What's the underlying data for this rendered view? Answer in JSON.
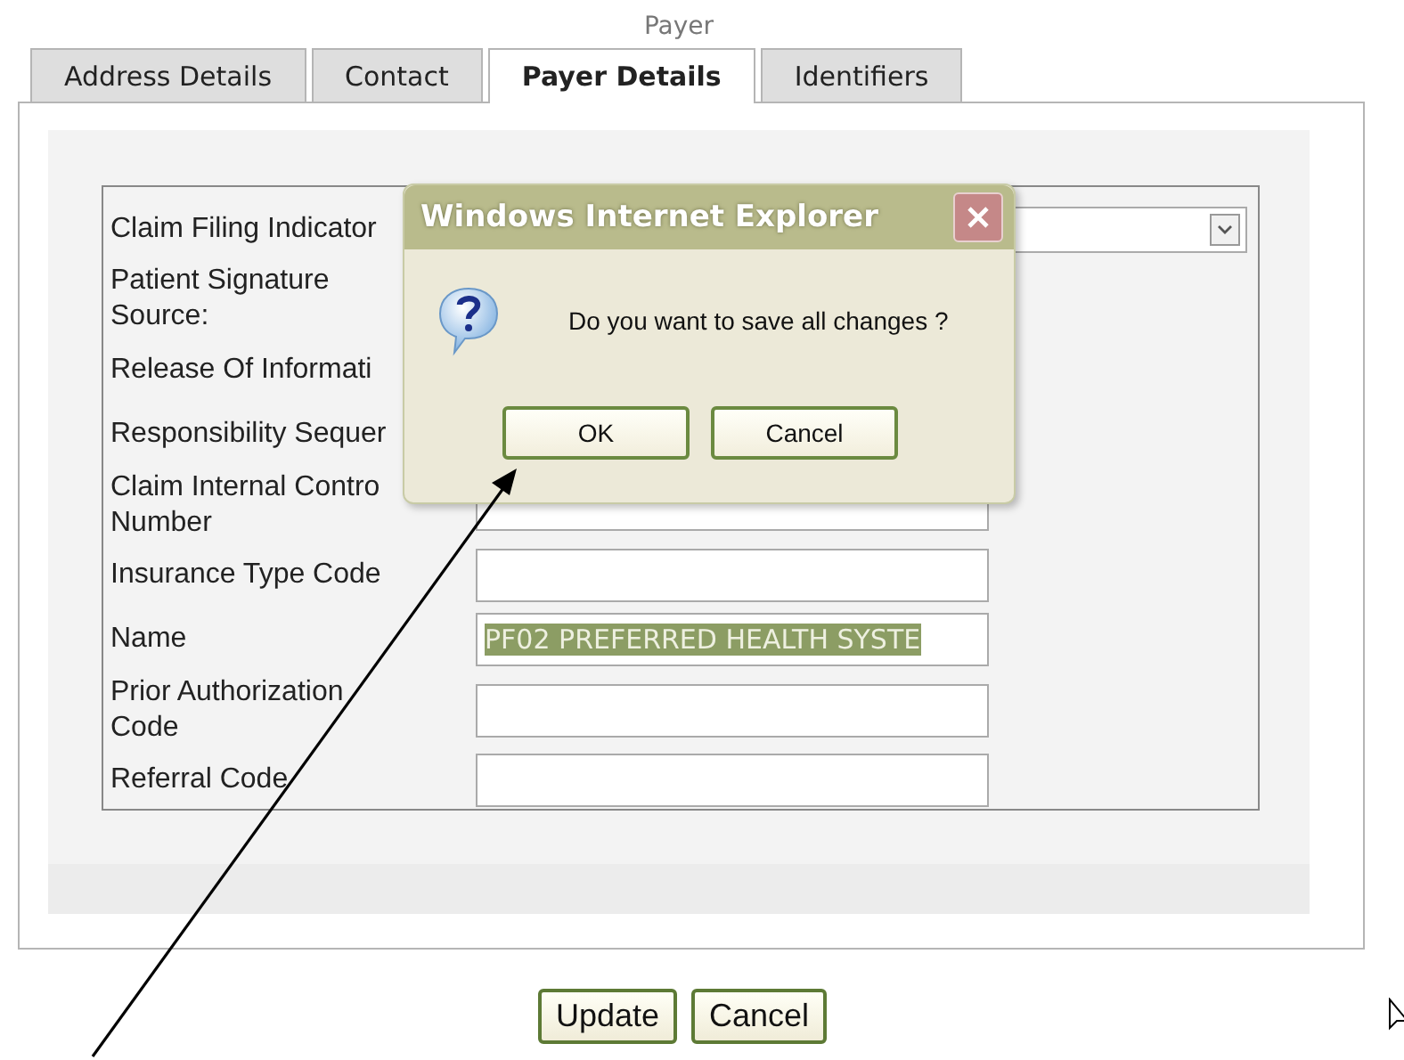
{
  "title": "Payer",
  "tabs": [
    {
      "label": "Address Details",
      "selected": false
    },
    {
      "label": "Contact",
      "selected": false
    },
    {
      "label": "Payer Details",
      "selected": true
    },
    {
      "label": "Identifiers",
      "selected": false
    }
  ],
  "form": {
    "rows": [
      {
        "label": "Claim Filing Indicator",
        "kind": "select"
      },
      {
        "label": "Patient Signature Source:",
        "kind": "label"
      },
      {
        "label": "Release Of Informati",
        "kind": "label"
      },
      {
        "label": "Responsibility Sequer",
        "kind": "label"
      },
      {
        "label": "Claim Internal Contro Number",
        "kind": "text"
      },
      {
        "label": "Insurance Type Code",
        "kind": "text"
      },
      {
        "label": "Name",
        "kind": "text",
        "value": "PF02 PREFERRED HEALTH SYSTE",
        "highlighted": true
      },
      {
        "label": "Prior Authorization Code",
        "kind": "text"
      },
      {
        "label": "Referral Code",
        "kind": "text"
      }
    ]
  },
  "dialog": {
    "title": "Windows Internet Explorer",
    "message": "Do you want to save all changes ?",
    "buttons": [
      "OK",
      "Cancel"
    ]
  },
  "buttons": [
    "Update",
    "Cancel"
  ]
}
